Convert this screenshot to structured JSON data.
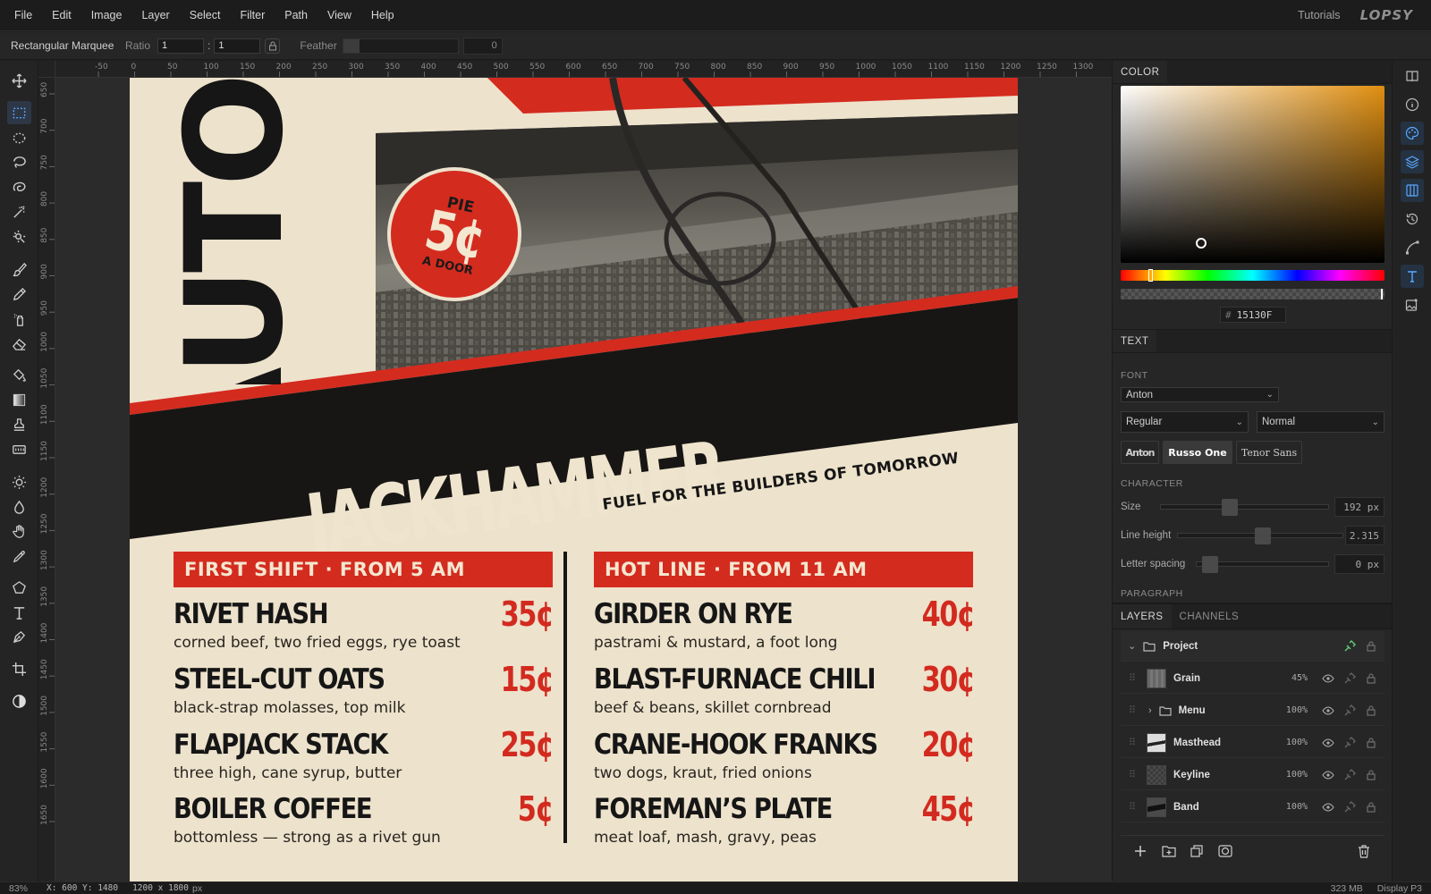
{
  "menubar": {
    "items": [
      "File",
      "Edit",
      "Image",
      "Layer",
      "Select",
      "Filter",
      "Path",
      "View",
      "Help"
    ],
    "tutorials": "Tutorials",
    "logo": "LOPSY"
  },
  "options": {
    "tool_name": "Rectangular Marquee",
    "ratio_label": "Ratio",
    "ratio_w": "1",
    "ratio_sep": ":",
    "ratio_h": "1",
    "feather_label": "Feather",
    "feather_value": "0"
  },
  "ruler": {
    "top_ticks": [
      "-50",
      "0",
      "50",
      "100",
      "150",
      "200",
      "250",
      "300",
      "350",
      "400",
      "450",
      "500",
      "550",
      "600",
      "650",
      "700",
      "750",
      "800",
      "850",
      "900",
      "950",
      "1000",
      "1050",
      "1100",
      "1150",
      "1200",
      "1250",
      "1300"
    ],
    "left_ticks": [
      "650",
      "700",
      "750",
      "800",
      "850",
      "900",
      "950",
      "1000",
      "1050",
      "1100",
      "1150",
      "1200",
      "1250",
      "1300",
      "1350",
      "1400",
      "1450",
      "1500",
      "1550",
      "1600",
      "1650"
    ]
  },
  "poster": {
    "vertical_word": "AUTON",
    "badge_top": "PIE",
    "badge_price": "5¢",
    "badge_bottom": "A DOOR",
    "headline": "JACKHAMMER",
    "tagline": "FUEL FOR THE BUILDERS OF TOMORROW",
    "left_header": "FIRST SHIFT · FROM 5 AM",
    "right_header": "HOT LINE · FROM 11 AM",
    "left_items": [
      {
        "name": "RIVET HASH",
        "desc": "corned beef, two fried eggs, rye toast",
        "price": "35¢"
      },
      {
        "name": "STEEL-CUT OATS",
        "desc": "black-strap molasses, top milk",
        "price": "15¢"
      },
      {
        "name": "FLAPJACK STACK",
        "desc": "three high, cane syrup, butter",
        "price": "25¢"
      },
      {
        "name": "BOILER COFFEE",
        "desc": "bottomless — strong as a rivet gun",
        "price": "5¢"
      }
    ],
    "right_items": [
      {
        "name": "GIRDER ON RYE",
        "desc": "pastrami & mustard, a foot long",
        "price": "40¢"
      },
      {
        "name": "BLAST-FURNACE CHILI",
        "desc": "beef & beans, skillet cornbread",
        "price": "30¢"
      },
      {
        "name": "CRANE-HOOK FRANKS",
        "desc": "two dogs, kraut, fried onions",
        "price": "20¢"
      },
      {
        "name": "FOREMAN’S PLATE",
        "desc": "meat loaf, mash, gravy, peas",
        "price": "45¢"
      }
    ]
  },
  "color_panel": {
    "tab": "COLOR",
    "hex_prefix": "#",
    "hex": "15130F",
    "hue_color": "#e08f10"
  },
  "text_panel": {
    "tab": "TEXT",
    "font_label": "FONT",
    "font": "Anton",
    "style": "Regular",
    "mode": "Normal",
    "chips": [
      "Anton",
      "Russo One",
      "Tenor Sans"
    ],
    "character_label": "CHARACTER",
    "size_label": "Size",
    "size_value": "192 px",
    "size_level": 0.4,
    "line_height_label": "Line height",
    "line_height_value": "2.315",
    "line_height_level": 0.52,
    "letter_spacing_label": "Letter spacing",
    "letter_spacing_value": "0 px",
    "letter_spacing_level": 0.05,
    "paragraph_label": "PARAGRAPH"
  },
  "layers_panel": {
    "tabs": [
      "LAYERS",
      "CHANNELS"
    ],
    "project": "Project",
    "layers": [
      {
        "name": "Grain",
        "opacity": "45%"
      },
      {
        "name": "Menu",
        "opacity": "100%"
      },
      {
        "name": "Masthead",
        "opacity": "100%"
      },
      {
        "name": "Keyline",
        "opacity": "100%"
      },
      {
        "name": "Band",
        "opacity": "100%"
      }
    ]
  },
  "status": {
    "zoom": "83%",
    "coords": "X: 600  Y: 1480",
    "doc_size": "1200 x 1800",
    "doc_unit": "px",
    "memory": "323 MB",
    "profile": "Display P3"
  },
  "colors": {
    "accent": "#d42b1f",
    "paper": "#ede2cc",
    "ink": "#161616"
  }
}
